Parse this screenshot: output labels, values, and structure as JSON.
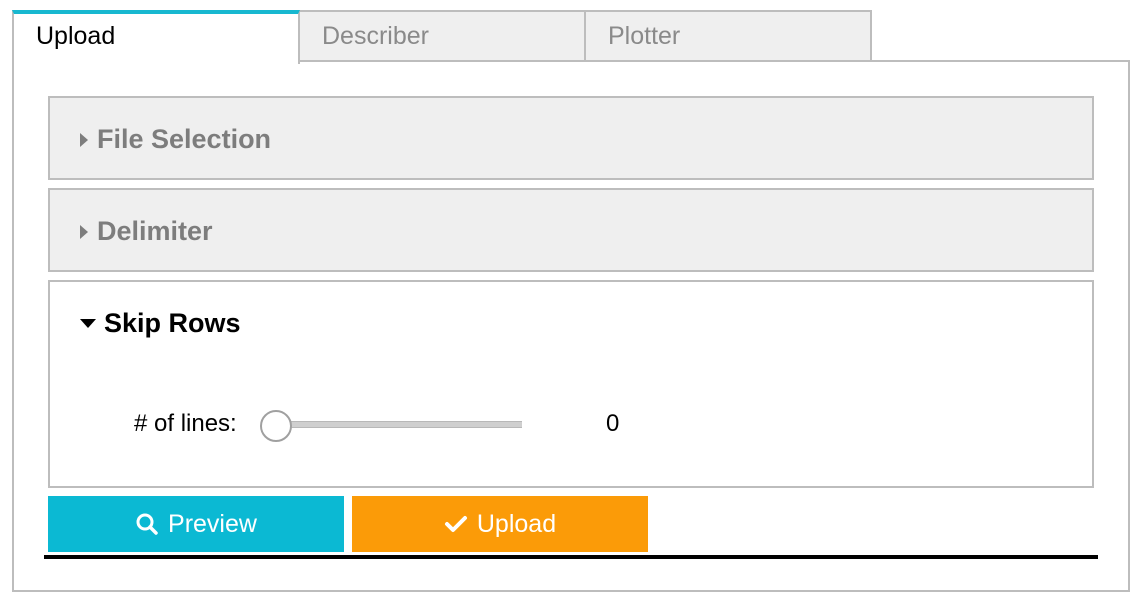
{
  "tabs": [
    {
      "label": "Upload",
      "active": true
    },
    {
      "label": "Describer",
      "active": false
    },
    {
      "label": "Plotter",
      "active": false
    }
  ],
  "accordion": {
    "file_selection": {
      "title": "File Selection",
      "expanded": false
    },
    "delimiter": {
      "title": "Delimiter",
      "expanded": false
    },
    "skip_rows": {
      "title": "Skip Rows",
      "expanded": true,
      "slider": {
        "label": "# of lines:",
        "value": "0",
        "min": 0,
        "fraction": 0.0
      }
    }
  },
  "buttons": {
    "preview": {
      "label": "Preview",
      "icon": "search-icon",
      "color": "#0bb9d3"
    },
    "upload": {
      "label": "Upload",
      "icon": "check-icon",
      "color": "#fb9b08"
    }
  },
  "colors": {
    "active_tab_accent": "#17b8d0",
    "collapsed_bg": "#efefef",
    "border": "#bdbdbd"
  }
}
